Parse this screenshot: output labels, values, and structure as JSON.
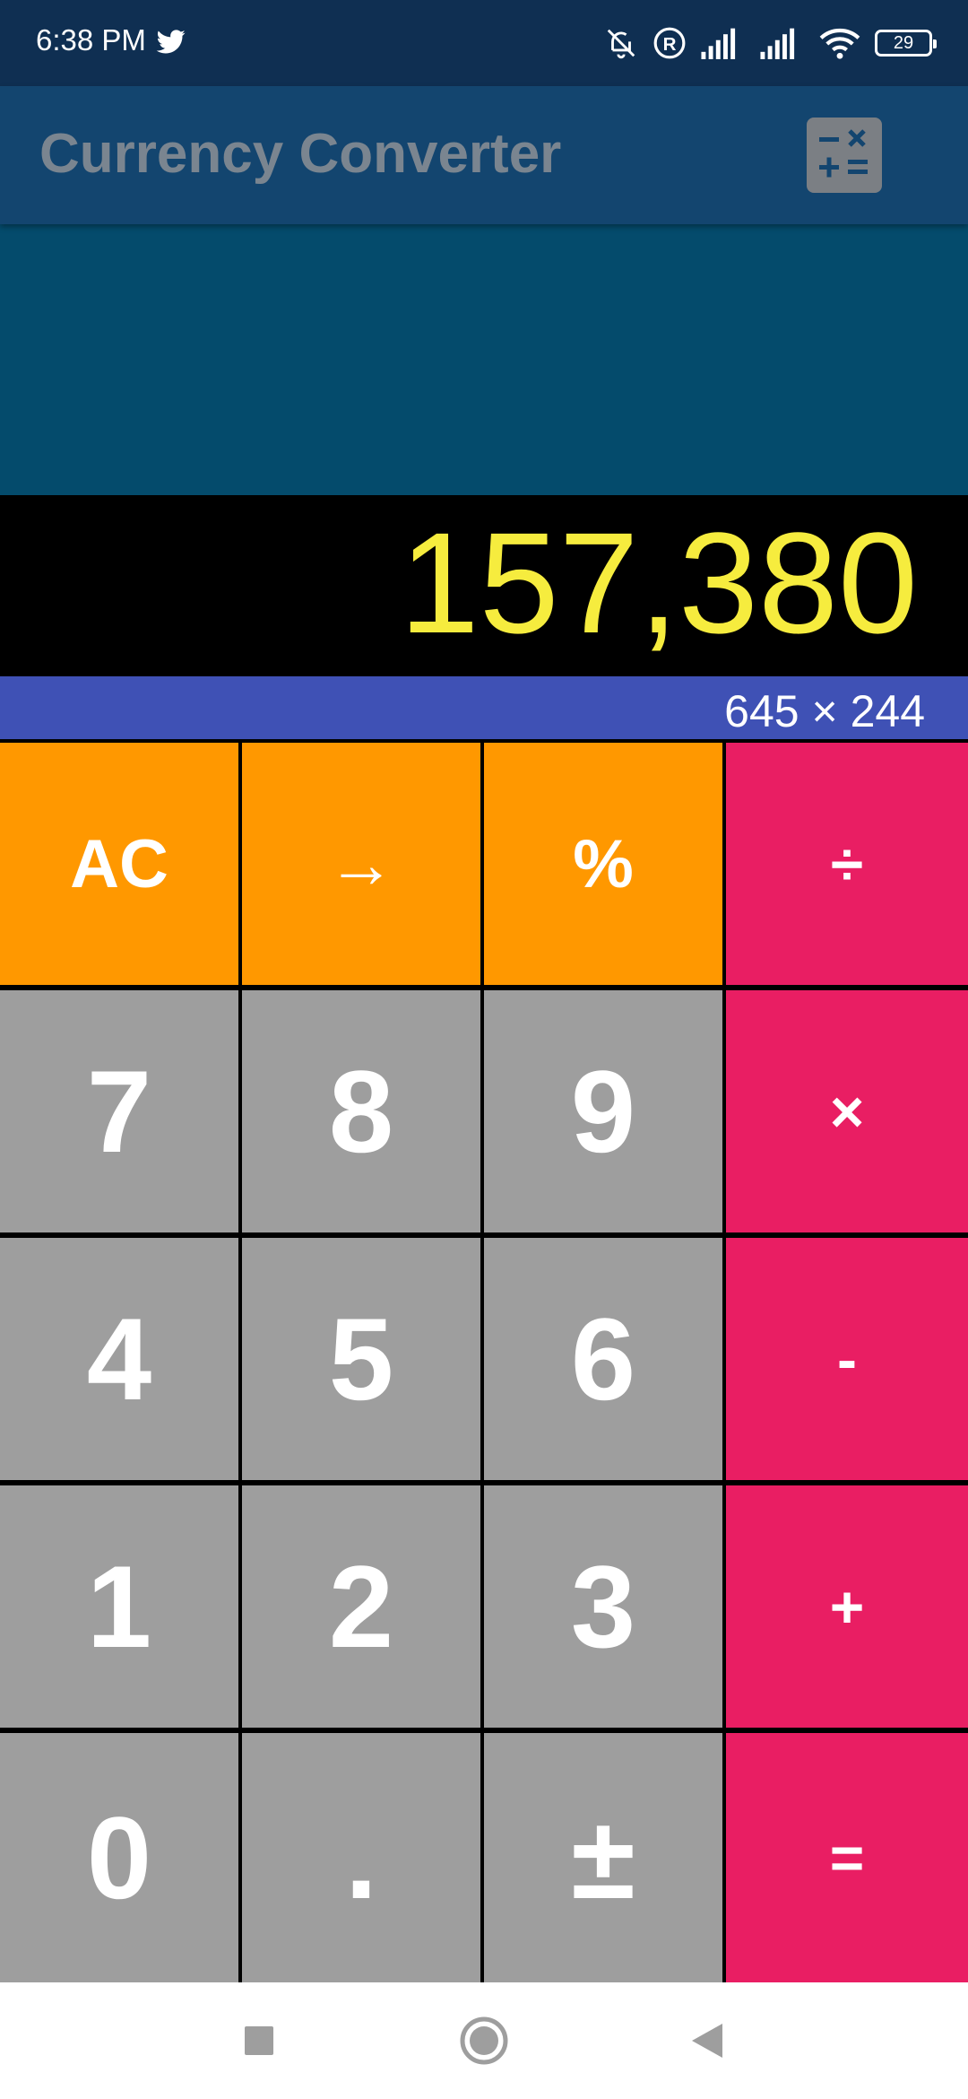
{
  "status_bar": {
    "time": "6:38 PM",
    "battery": "29",
    "icons": [
      "twitter-icon",
      "bell-muted-icon",
      "registered-icon",
      "signal-icon",
      "signal-icon",
      "wifi-icon",
      "battery-icon"
    ]
  },
  "app_bar": {
    "title": "Currency Converter",
    "toggle_icon": "calculator-icon"
  },
  "display": {
    "value": "157,380",
    "expression": "645 × 244"
  },
  "keypad": {
    "row1": [
      "AC",
      "→",
      "%",
      "÷"
    ],
    "row2": [
      "7",
      "8",
      "9",
      "×"
    ],
    "row3": [
      "4",
      "5",
      "6",
      "-"
    ],
    "row4": [
      "1",
      "2",
      "3",
      "+"
    ],
    "row5": [
      "0",
      ".",
      "±",
      "="
    ]
  },
  "nav_bar": {
    "icons": [
      "recents-square-icon",
      "home-circle-icon",
      "back-triangle-icon"
    ]
  },
  "colors": {
    "status_bar": "#0f2f52",
    "app_bar": "#13456f",
    "ad_area": "#044b6c",
    "display_text": "#f6ec3e",
    "expression_bar": "#3f51b5",
    "key_orange": "#ff9800",
    "key_gray": "#9e9e9e",
    "key_pink": "#e91e63"
  }
}
